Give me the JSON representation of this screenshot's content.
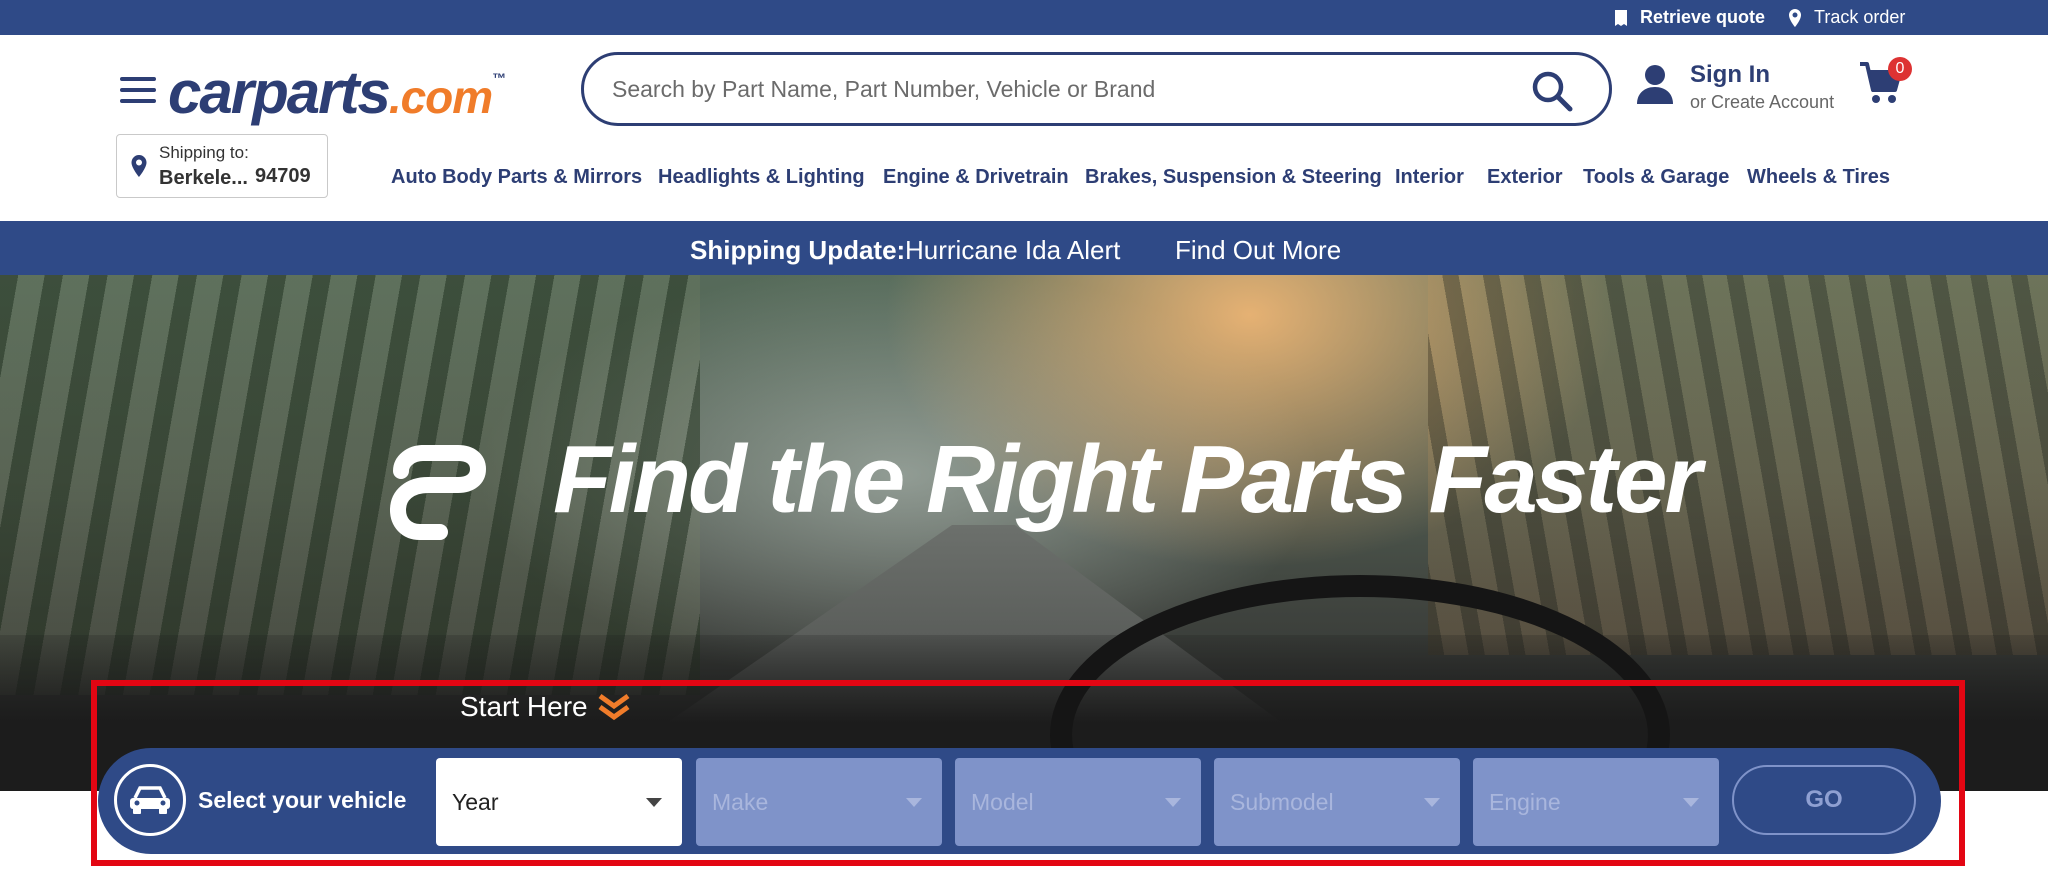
{
  "topbar": {
    "retrieve_quote": "Retrieve quote",
    "track_order": "Track order"
  },
  "header": {
    "logo_main": "carparts",
    "logo_suffix": ".com",
    "logo_tm": "™",
    "search_placeholder": "Search by Part Name, Part Number, Vehicle or Brand",
    "account": {
      "sign_in": "Sign In",
      "create": "or Create Account"
    },
    "cart_count": "0",
    "shipping": {
      "label": "Shipping to:",
      "city": "Berkele...",
      "zip": "94709"
    }
  },
  "nav": {
    "items": [
      "Auto Body Parts & Mirrors",
      "Headlights & Lighting",
      "Engine & Drivetrain",
      "Brakes, Suspension & Steering",
      "Interior",
      "Exterior",
      "Tools & Garage",
      "Wheels & Tires"
    ]
  },
  "banner": {
    "title": "Shipping Update:",
    "message": "Hurricane Ida Alert",
    "link": "Find Out More"
  },
  "hero": {
    "title": "Find the Right Parts Faster",
    "start_here": "Start Here"
  },
  "vehicle_selector": {
    "label": "Select your vehicle",
    "year": "Year",
    "make": "Make",
    "model": "Model",
    "submodel": "Submodel",
    "engine": "Engine",
    "go": "GO"
  },
  "colors": {
    "navy": "#2f4a87",
    "brand_text": "#2d3e74",
    "accent_orange": "#f07c2a",
    "disabled_select": "#7f93c9",
    "highlight_red": "#e30613"
  },
  "icons": [
    "receipt-icon",
    "location-pin-icon",
    "hamburger-menu-icon",
    "search-icon",
    "user-icon",
    "cart-icon",
    "double-chevron-down-icon",
    "car-icon",
    "brand-mark-icon"
  ]
}
